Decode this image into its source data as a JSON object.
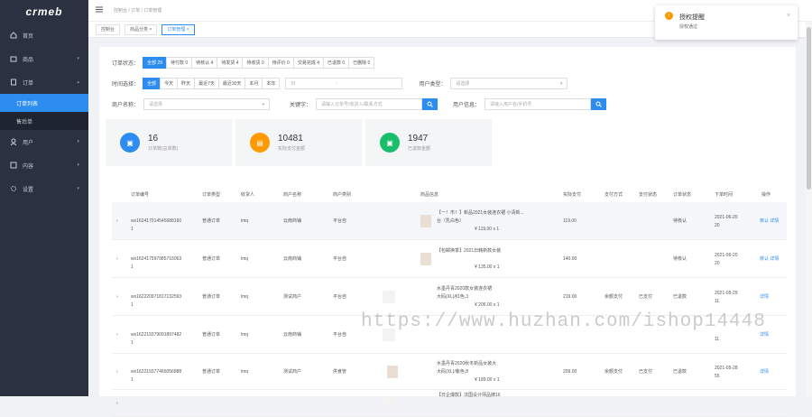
{
  "logo": "crmeb",
  "sidebar": {
    "items": [
      {
        "label": "首页"
      },
      {
        "label": "商品"
      },
      {
        "label": "订单"
      },
      {
        "label": "用户"
      },
      {
        "label": "内容"
      },
      {
        "label": "设置"
      }
    ],
    "subs": [
      {
        "label": "订单列表"
      },
      {
        "label": "售后单"
      }
    ]
  },
  "breadcrumb": "控制台 / 订单 / 订单管理",
  "tabs": [
    "控制台",
    "商品分类",
    "订单管理"
  ],
  "filters": {
    "status_label": "订单状态：",
    "status": [
      "全部 29",
      "待付款 0",
      "待核认 4",
      "待发货 4",
      "待收货 0",
      "待评价 0",
      "交易完成 4",
      "已退款 0",
      "已删除 0"
    ],
    "time_label": "时间选择：",
    "time": [
      "全部",
      "今天",
      "昨天",
      "最近7天",
      "最近30天",
      "本月",
      "本年"
    ],
    "date_placeholder": "日",
    "date_sep": "-",
    "user_type_label": "用户类型：",
    "user_type_placeholder": "请选择",
    "merchant_label": "商户名称：",
    "merchant_placeholder": "请选择",
    "keyword_label": "关键字：",
    "keyword_placeholder": "请输入订单号/收货人/联系方式",
    "user_info_label": "用户信息：",
    "user_info_placeholder": "请输入用户名/手机号"
  },
  "cards": [
    {
      "value": "16",
      "label": "订单数(总单数)",
      "color": "#2d8cf0"
    },
    {
      "value": "10481",
      "label": "实际支付金额",
      "color": "#ff9900"
    },
    {
      "value": "1947",
      "label": "已退款金额",
      "color": "#19be6b"
    }
  ],
  "table": {
    "headers": [
      "订单编号",
      "订单类型",
      "收货人",
      "商户名称",
      "商户类别",
      "商品信息",
      "实际支付",
      "支付方式",
      "支付状态",
      "订单状态",
      "下单时间",
      "操作"
    ],
    "rows": [
      {
        "id": "wx162417014545688160",
        "id2": "1",
        "type": "普通订单",
        "user": "lmq",
        "merchant": "云南商铺",
        "cat": "平台自",
        "goods": "【一！市！】新品2021女装连衣裙 小清新...",
        "goods2": "台（乳白色）",
        "price": "¥ 119.00 x 1",
        "paid": "119.00",
        "pay": "",
        "paystate": "",
        "state": "待核认",
        "time": "2021-06-20",
        "time2": "20",
        "ops": "核认  详情"
      },
      {
        "id": "wx162417597985716063",
        "id2": "1",
        "type": "普通订单",
        "user": "lmq",
        "merchant": "云南商铺",
        "cat": "平台自",
        "goods": "【包邮换季】2021日韩新款女装",
        "goods2": "",
        "price": "¥ 135.00 x 1",
        "paid": "140.00",
        "pay": "",
        "paystate": "",
        "state": "待核认",
        "time": "2021-06-20",
        "time2": "20",
        "ops": "核认  详情"
      },
      {
        "id": "wx162220971817132593",
        "id2": "1",
        "type": "普通订单",
        "user": "lmq",
        "merchant": "测试商户",
        "cat": "平台自",
        "goods": "水墨丹青2020款女装连衣裙",
        "goods2": "大码(XL)/红色,3",
        "price": "¥ 206.00 x 1",
        "paid": "219.00",
        "pay": "余额支付",
        "paystate": "已支付",
        "state": "已退款",
        "time": "2021-05-29",
        "time2": "11",
        "ops": "详情"
      },
      {
        "id": "wx162219379091897482",
        "id2": "1",
        "type": "普通订单",
        "user": "lmq",
        "merchant": "云南商铺",
        "cat": "平台自",
        "goods": "",
        "goods2": "",
        "price": "",
        "paid": "",
        "pay": "",
        "paystate": "",
        "state": "",
        "time": "",
        "time2": "11",
        "ops": "详情"
      },
      {
        "id": "wx162219377466056888",
        "id2": "1",
        "type": "普通订单",
        "user": "lmq",
        "merchant": "测试商户",
        "cat": "供食管",
        "goods": "水墨丹青2020秋冬新品女装大",
        "goods2": "大码(XL)/紫色,8",
        "price": "¥ 189.00 x 1",
        "paid": "209.00",
        "pay": "余额支付",
        "paystate": "已支付",
        "state": "已退款",
        "time": "2021-05-28",
        "time2": "55",
        "ops": "详情"
      },
      {
        "id": "",
        "id2": "",
        "type": "",
        "user": "",
        "merchant": "",
        "cat": "",
        "goods": "【日企爆款】法国设计师品牌16",
        "goods2": "",
        "price": "",
        "paid": "",
        "pay": "",
        "paystate": "",
        "state": "",
        "time": "",
        "time2": "",
        "ops": ""
      }
    ]
  },
  "notice": {
    "title": "授权提醒",
    "body": "授权通过"
  },
  "watermark": "https://www.huzhan.com/ishop14448"
}
